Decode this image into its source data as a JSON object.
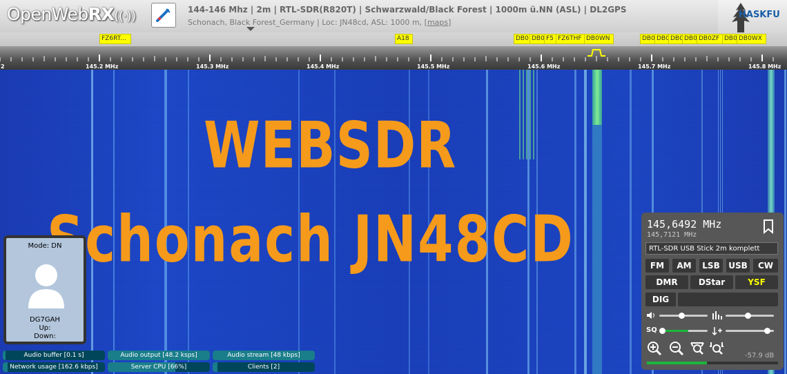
{
  "header": {
    "logo_open": "Open",
    "logo_web": "Web",
    "logo_rx": "RX",
    "logo_radio": "((·))",
    "title": "144-146 Mhz | 2m | RTL-SDR(R820T) | Schwarzwald/Black Forest | 1000m ü.NN (ASL) | DL2GPS",
    "desc_prefix": "Schonach, Black Forest_Germany | Loc: JN48cd, ASL: 1000 m, [",
    "desc_link": "maps",
    "desc_suffix": "]",
    "sponsor": "HASKFU"
  },
  "bookmarks": [
    {
      "label": "FZ6RT..."
    },
    {
      "label": "A18"
    },
    {
      "label": "DB0"
    },
    {
      "label": "DB0"
    },
    {
      "label": "F5"
    },
    {
      "label": "FZ6THF"
    },
    {
      "label": "DB0WN"
    },
    {
      "label": "DB0"
    },
    {
      "label": "DB0"
    },
    {
      "label": "DB0"
    },
    {
      "label": "DB0"
    },
    {
      "label": "DB0ZF"
    },
    {
      "label": "DB0"
    },
    {
      "label": "DB0WX"
    }
  ],
  "scale": {
    "labels": [
      "145.2 MHz",
      "145.3 MHz",
      "145.4 MHz",
      "145.5 MHz",
      "145.6 MHz",
      "145.7 MHz",
      "145.8 MHz"
    ],
    "left_edge_label": "2"
  },
  "watermark": {
    "line1": "WEBSDR",
    "line2": "Schonach JN48CD"
  },
  "digimode": {
    "mode": "Mode: DN",
    "callsign": "DG7GAH",
    "up": "Up:",
    "down": "Down:"
  },
  "status": {
    "audio_buffer": "Audio buffer [0.1 s]",
    "audio_output": "Audio output [48.2 ksps]",
    "audio_stream": "Audio stream [48 kbps]",
    "network_usage": "Network usage [162.6 kbps]",
    "server_cpu": "Server CPU [66%]",
    "clients": "Clients [2]",
    "audio_buffer_level": 0.03,
    "audio_output_level": 1.0,
    "audio_stream_level": 1.0,
    "network_usage_level": 0.05,
    "server_cpu_level": 0.66,
    "clients_level": 0.05
  },
  "receiver": {
    "frequency": "145,6492 MHz",
    "frequency_sub": "145,7121 MHz",
    "profile": "RTL-SDR USB Stick 2m komplett",
    "modes_row1": [
      "FM",
      "AM",
      "LSB",
      "USB",
      "CW"
    ],
    "modes_row2": [
      "DMR",
      "DStar",
      "YSF"
    ],
    "modes_row3": [
      "DIG"
    ],
    "active_mode": "YSF",
    "squelch_label": "SQ",
    "volume_level": 0.45,
    "nr_level": 0.45,
    "squelch_level": 0.05,
    "gain_level": 0.85,
    "smeter_db": "-57.9 dB",
    "smeter_level": 0.46
  },
  "colors": {
    "bookmark": "#ffff00",
    "waterfall_bg": "#1a3fb8",
    "watermark": "#f59a1a",
    "active_mode": "#ffff00",
    "smeter": "#1ab83a"
  }
}
